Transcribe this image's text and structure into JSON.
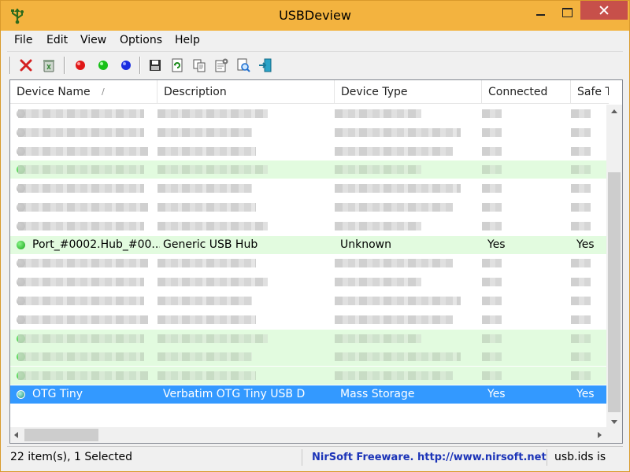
{
  "window": {
    "title": "USBDeview"
  },
  "menu": [
    "File",
    "Edit",
    "View",
    "Options",
    "Help"
  ],
  "toolbar": {
    "icons": [
      "delete-icon",
      "uninstall-icon",
      "red-dot-icon",
      "green-dot-icon",
      "blue-dot-icon",
      "save-icon",
      "refresh-icon",
      "copy-icon",
      "properties-icon",
      "find-icon",
      "exit-icon"
    ]
  },
  "columns": [
    "Device Name",
    "Description",
    "Device Type",
    "Connected",
    "Safe T"
  ],
  "rows": [
    {
      "type": "blurred",
      "status": "gray"
    },
    {
      "type": "blurred",
      "status": "gray"
    },
    {
      "type": "blurred",
      "status": "gray"
    },
    {
      "type": "blurred",
      "status": "green",
      "highlight": true
    },
    {
      "type": "blurred",
      "status": "gray"
    },
    {
      "type": "blurred",
      "status": "gray"
    },
    {
      "type": "blurred",
      "status": "gray"
    },
    {
      "type": "visible",
      "status": "green",
      "highlight": true,
      "cells": [
        "Port_#0002.Hub_#00...",
        "Generic USB Hub",
        "Unknown",
        "Yes",
        "Yes"
      ]
    },
    {
      "type": "blurred",
      "status": "gray"
    },
    {
      "type": "blurred",
      "status": "gray"
    },
    {
      "type": "blurred",
      "status": "gray"
    },
    {
      "type": "blurred",
      "status": "gray"
    },
    {
      "type": "blurred",
      "status": "green",
      "highlight": true
    },
    {
      "type": "blurred",
      "status": "green",
      "highlight": true
    },
    {
      "type": "blurred",
      "status": "green",
      "highlight": true
    },
    {
      "type": "visible",
      "status": "teal",
      "selected": true,
      "cells": [
        "OTG Tiny",
        "Verbatim OTG Tiny USB Device",
        "Mass Storage",
        "Yes",
        "Yes"
      ]
    }
  ],
  "status": {
    "count": "22 item(s), 1 Selected",
    "credit": "NirSoft Freeware.  http://www.nirsoft.net",
    "extra": "usb.ids is"
  }
}
